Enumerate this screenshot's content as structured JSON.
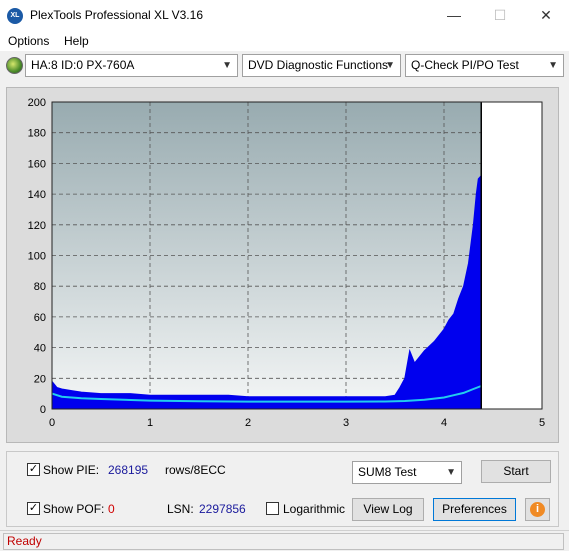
{
  "window": {
    "title": "PlexTools Professional XL V3.16",
    "icon_text": "XL"
  },
  "menu": {
    "options": "Options",
    "help": "Help"
  },
  "toolbar": {
    "drive": "HA:8 ID:0  PX-760A",
    "function": "DVD Diagnostic Functions",
    "test": "Q-Check PI/PO Test"
  },
  "chart_data": {
    "type": "area",
    "x_ticks": [
      "0",
      "1",
      "2",
      "3",
      "4",
      "5"
    ],
    "y_ticks": [
      "0",
      "20",
      "40",
      "60",
      "80",
      "100",
      "120",
      "140",
      "160",
      "180",
      "200"
    ],
    "xlim": [
      0,
      5
    ],
    "ylim": [
      0,
      200
    ],
    "grid": true,
    "end_marker_x": 4.38,
    "series": [
      {
        "color": "#0000ee",
        "x": [
          0,
          0.05,
          0.1,
          0.2,
          0.3,
          0.5,
          0.8,
          1.0,
          1.2,
          1.5,
          1.8,
          2.0,
          2.2,
          2.5,
          2.8,
          3.0,
          3.2,
          3.4,
          3.5,
          3.55,
          3.6,
          3.65,
          3.7,
          3.8,
          3.9,
          4.0,
          4.05,
          4.1,
          4.15,
          4.2,
          4.25,
          4.3,
          4.33,
          4.35,
          4.38
        ],
        "values": [
          18,
          14,
          13,
          12,
          11,
          10,
          10,
          9,
          9,
          9,
          9,
          8,
          8,
          8,
          8,
          8,
          8,
          8,
          9,
          14,
          20,
          38,
          30,
          38,
          44,
          52,
          58,
          62,
          72,
          80,
          95,
          120,
          140,
          150,
          152
        ]
      },
      {
        "color": "#22ccee",
        "x": [
          0,
          0.1,
          0.3,
          0.5,
          1.0,
          1.5,
          2.0,
          2.5,
          3.0,
          3.4,
          3.6,
          3.8,
          4.0,
          4.1,
          4.2,
          4.3,
          4.38
        ],
        "values": [
          10,
          8,
          7,
          6.5,
          5.5,
          5,
          4.8,
          4.8,
          4.8,
          4.9,
          5.2,
          6,
          7.5,
          9,
          10.5,
          13,
          15
        ]
      }
    ]
  },
  "bottom": {
    "show_pie_label": "Show PIE:",
    "pie_value": "268195",
    "pie_unit": "rows/8ECC",
    "show_pof_label": "Show POF:",
    "pof_value": "0",
    "lsn_label": "LSN:",
    "lsn_value": "2297856",
    "logarithmic_label": "Logarithmic",
    "test_select": "SUM8 Test",
    "start_label": "Start",
    "view_log_label": "View Log",
    "preferences_label": "Preferences"
  },
  "status": {
    "text": "Ready"
  }
}
